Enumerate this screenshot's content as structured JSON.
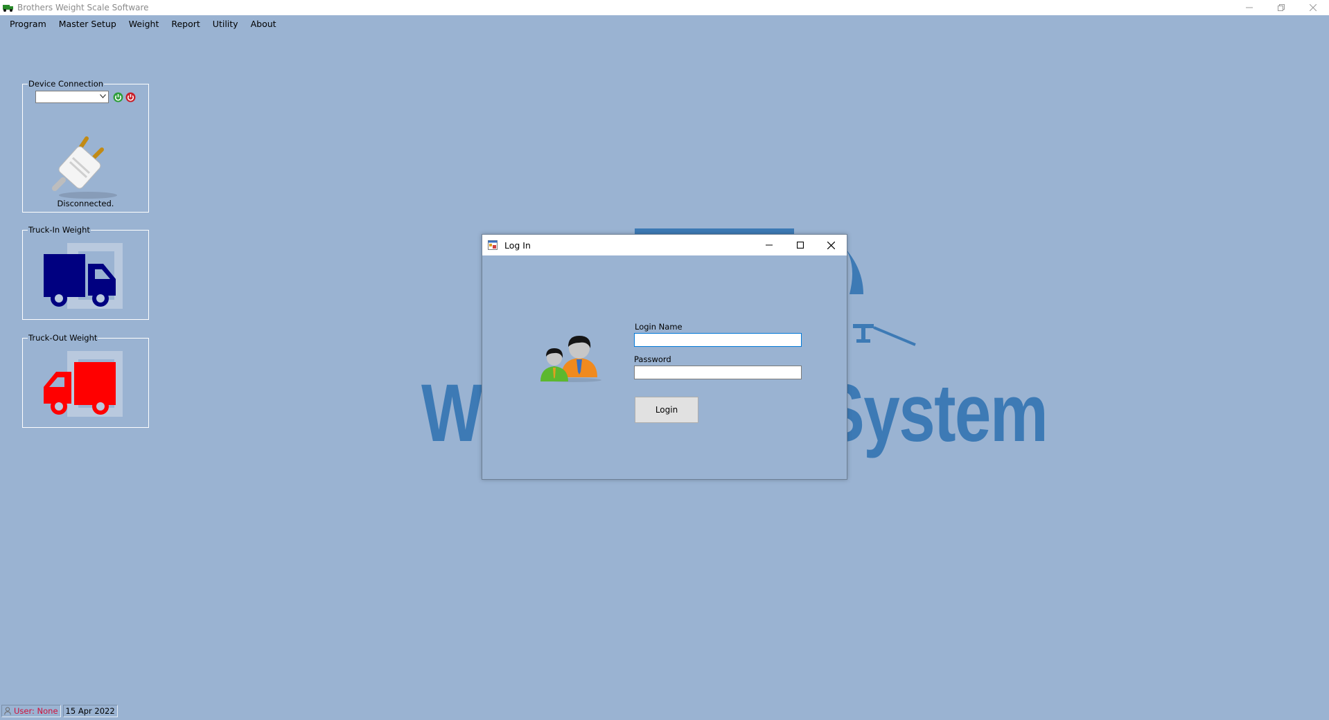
{
  "window": {
    "title": "Brothers Weight Scale Software"
  },
  "menu": {
    "items": [
      "Program",
      "Master Setup",
      "Weight",
      "Report",
      "Utility",
      "About"
    ]
  },
  "device_connection": {
    "title": "Device Connection",
    "selected_port": "",
    "status": "Disconnected.",
    "connect_icon": "power-green-icon",
    "disconnect_icon": "power-red-icon",
    "plug_icon": "plug-icon"
  },
  "truck_in": {
    "title": "Truck-In Weight",
    "icon": "truck-icon",
    "color": "#000080"
  },
  "truck_out": {
    "title": "Truck-Out Weight",
    "icon": "truck-icon",
    "color": "#ff0000"
  },
  "background": {
    "watermark_text": "Weighbridge System",
    "color": "#3d7ab5"
  },
  "login_dialog": {
    "title": "Log In",
    "login_name_label": "Login Name",
    "login_name_value": "",
    "password_label": "Password",
    "password_value": "",
    "login_button": "Login",
    "users_icon": "users-icon"
  },
  "statusbar": {
    "user": "User: None",
    "date": "15 Apr 2022"
  }
}
